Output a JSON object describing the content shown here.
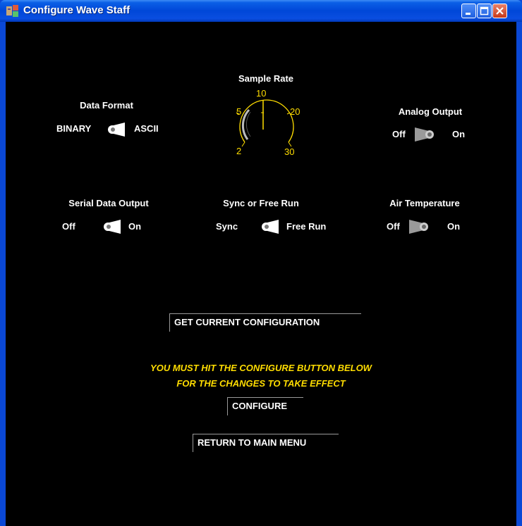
{
  "window": {
    "title": "Configure Wave Staff",
    "controls": [
      "minimize-icon",
      "maximize-icon",
      "close-icon"
    ]
  },
  "controls": {
    "data_format": {
      "heading": "Data Format",
      "left_label": "BINARY",
      "right_label": "ASCII",
      "selected": "ASCII"
    },
    "analog_output": {
      "heading": "Analog Output",
      "left_label": "Off",
      "right_label": "On",
      "selected": "Off"
    },
    "serial_data_output": {
      "heading": "Serial Data Output",
      "left_label": "Off",
      "right_label": "On",
      "selected": "On"
    },
    "sync_free_run": {
      "heading": "Sync or Free Run",
      "left_label": "Sync",
      "right_label": "Free Run",
      "selected": "Free Run"
    },
    "air_temperature": {
      "heading": "Air Temperature",
      "left_label": "Off",
      "right_label": "On",
      "selected": "Off"
    }
  },
  "sample_rate": {
    "heading": "Sample Rate",
    "ticks": [
      "2",
      "5",
      "10",
      "20",
      "30"
    ],
    "selected": "10"
  },
  "buttons": {
    "get_config": "GET CURRENT CONFIGURATION",
    "configure": "CONFIGURE",
    "return_menu": "RETURN TO MAIN MENU"
  },
  "warning": {
    "line1": "YOU MUST HIT THE CONFIGURE BUTTON BELOW",
    "line2": "FOR THE CHANGES TO TAKE EFFECT"
  },
  "colors": {
    "accent": "#ffdd00",
    "background": "#000000",
    "title_bar": "#0047d8"
  }
}
